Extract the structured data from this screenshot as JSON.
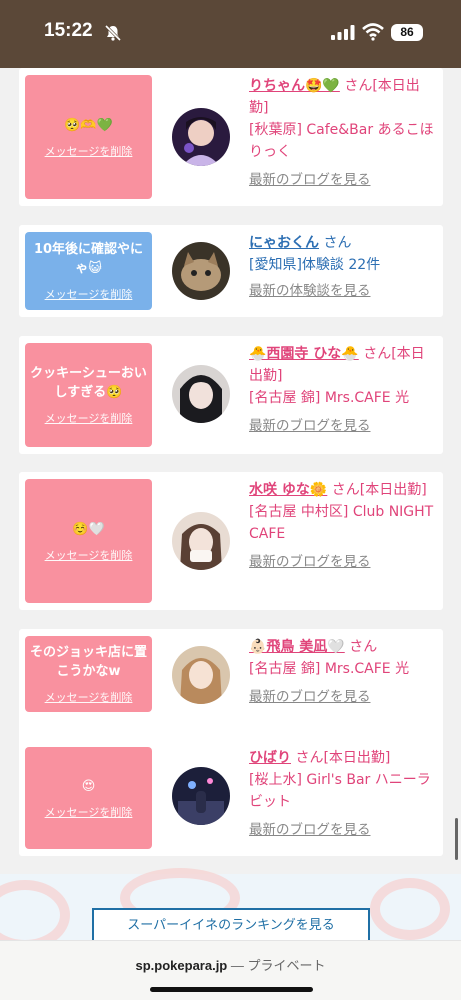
{
  "status": {
    "time": "15:22",
    "battery": "86"
  },
  "cards": [
    {
      "message": "🥺🫶💚",
      "delete_label": "メッセージを削除",
      "name": "りちゃん🤩💚",
      "honorific": "さん",
      "tag": "[本日出勤]",
      "location": "[秋葉原] Cafe&Bar あるこほりっく",
      "link": "最新のブログを見る"
    },
    {
      "message": "10年後に確認やにゃ😺",
      "delete_label": "メッセージを削除",
      "name": "にゃおくん",
      "honorific": "さん",
      "tag": "",
      "location": "[愛知県]体験談 22件",
      "link": "最新の体験談を見る"
    },
    {
      "message": "クッキーシューおいしすぎる🥺",
      "delete_label": "メッセージを削除",
      "name": "🐣西園寺 ひな🐣",
      "honorific": "さん",
      "tag": "[本日出勤]",
      "location": "[名古屋 錦] Mrs.CAFE 光",
      "link": "最新のブログを見る"
    },
    {
      "message": "☺️🤍",
      "delete_label": "メッセージを削除",
      "name": "水咲 ゆな🌼",
      "honorific": "さん",
      "tag": "[本日出勤]",
      "location": "[名古屋 中村区] Club NIGHT CAFE",
      "link": "最新のブログを見る"
    },
    {
      "message": "そのジョッキ店に置こうかなw",
      "delete_label": "メッセージを削除",
      "name": "👶🏻飛鳥 美凪🤍",
      "honorific": "さん",
      "tag": "",
      "location": "[名古屋 錦] Mrs.CAFE 光",
      "link": "最新のブログを見る"
    },
    {
      "message": "😍",
      "delete_label": "メッセージを削除",
      "name": "ひばり",
      "honorific": "さん",
      "tag": "[本日出勤]",
      "location": "[桜上水] Girl's Bar ハニーラビット",
      "link": "最新のブログを見る"
    }
  ],
  "ranking_button": "スーパーイイネのランキングを見る",
  "browser": {
    "domain": "sp.pokepara.jp",
    "mode": "— プライベート"
  },
  "colors": {
    "pink": "#f9919f",
    "blue": "#7ab1ea",
    "name_pink": "#e0447a",
    "name_blue": "#2d6fb3",
    "status_bg": "#5b4838"
  }
}
